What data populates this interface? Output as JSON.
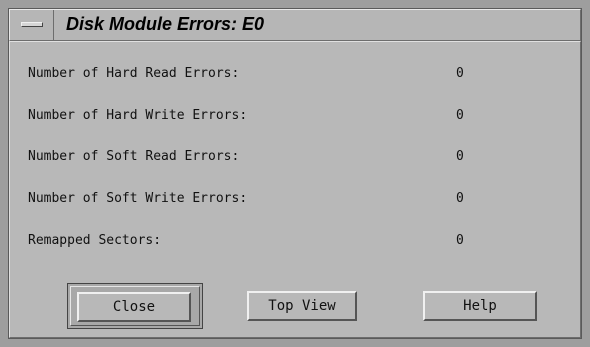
{
  "window": {
    "title": "Disk Module Errors: E0"
  },
  "stats": [
    {
      "label": "Number of Hard Read Errors:",
      "value": "0"
    },
    {
      "label": "Number of Hard Write Errors:",
      "value": "0"
    },
    {
      "label": "Number of Soft Read Errors:",
      "value": "0"
    },
    {
      "label": "Number of Soft Write Errors:",
      "value": "0"
    },
    {
      "label": "Remapped Sectors:",
      "value": "0"
    }
  ],
  "buttons": {
    "close_label": "Close",
    "top_view_label": "Top View",
    "help_label": "Help"
  },
  "icons": {
    "window_menu": "window-menu-icon"
  }
}
